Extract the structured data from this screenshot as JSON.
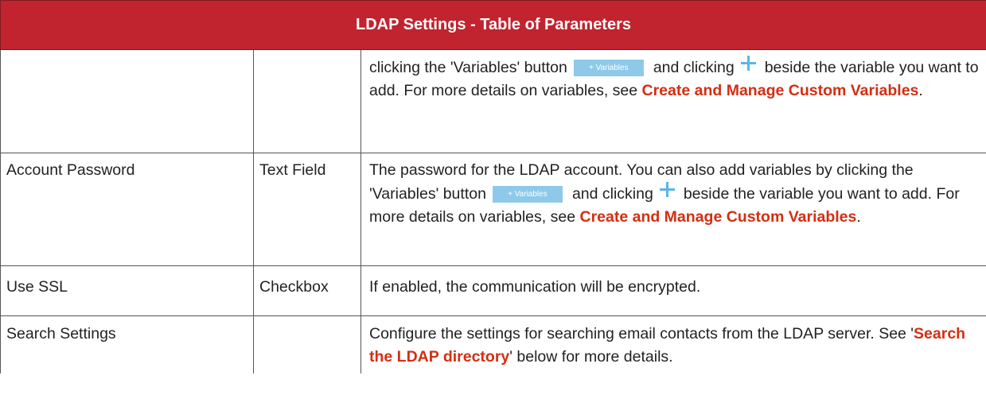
{
  "table": {
    "title": "LDAP Settings - Table of Parameters"
  },
  "rows": {
    "continued": {
      "desc": {
        "part1": "clicking the 'Variables' button",
        "button": "+ Variables",
        "part2": "and clicking",
        "part3": "beside the variable you want to add. For more details on variables, see",
        "link": "Create and Manage Custom Variables",
        "end": "."
      }
    },
    "account_password": {
      "param": "Account Password",
      "type": "Text Field",
      "desc": {
        "part0": "The password for the LDAP account. You can also add variables by clicking the 'Variables' button",
        "button": "+ Variables",
        "part2": "and clicking",
        "part3": "beside the variable you want to add. For more details on variables, see",
        "link": "Create and Manage Custom Variables",
        "end": "."
      }
    },
    "use_ssl": {
      "param": "Use SSL",
      "type": "Checkbox",
      "desc": "If enabled, the communication will be encrypted."
    },
    "search_settings": {
      "param": "Search Settings",
      "type": "",
      "desc": {
        "part1": "Configure the settings for searching email contacts from the LDAP server. See '",
        "link": "Search the LDAP directory",
        "part2": "' below for more details."
      }
    }
  },
  "icons": {
    "plus": "plus-icon",
    "plus_color": "#5ab6e6",
    "variables_button_color": "#8ec9ea",
    "header_color": "#c1232f",
    "link_color": "#d42e12"
  }
}
